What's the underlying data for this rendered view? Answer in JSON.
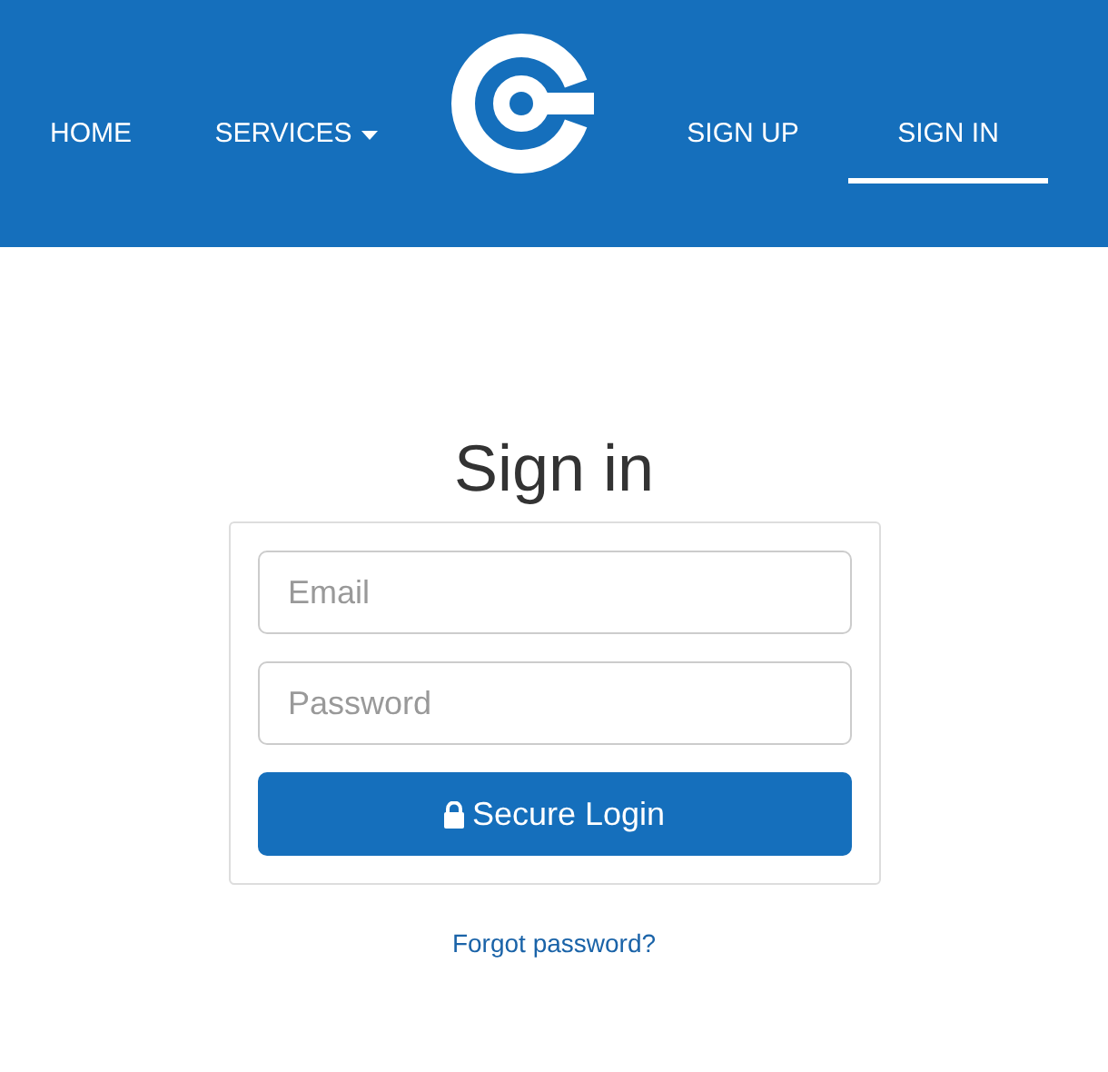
{
  "nav": {
    "left": [
      {
        "label": "HOME",
        "selected": false,
        "dropdown": false
      },
      {
        "label": "SERVICES",
        "selected": false,
        "dropdown": true
      }
    ],
    "right": [
      {
        "label": "SIGN UP",
        "selected": false,
        "dropdown": false
      },
      {
        "label": "SIGN IN",
        "selected": true,
        "dropdown": false
      }
    ]
  },
  "title": "Sign in",
  "form": {
    "fields": [
      {
        "placeholder": "Email"
      },
      {
        "placeholder": "Password"
      }
    ],
    "submit": "Secure Login"
  },
  "forgot_link": "Forgot password?"
}
